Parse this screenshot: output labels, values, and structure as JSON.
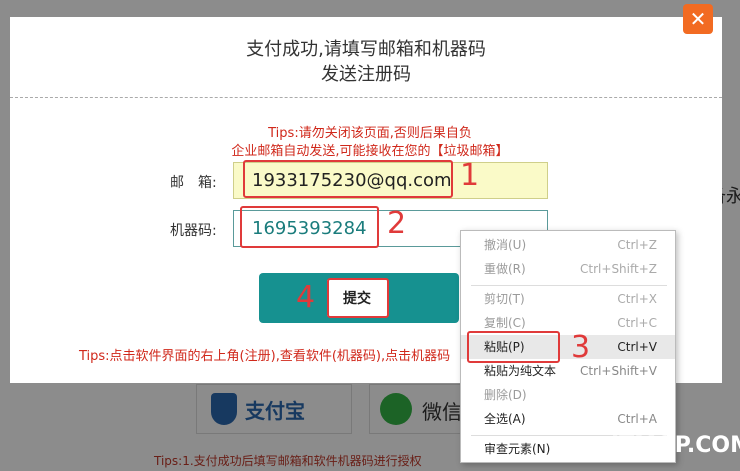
{
  "background": {
    "pay_alipay_label": "支付宝",
    "pay_wechat_label": "微信",
    "bottom_tip": "Tips:1.支付成功后填写邮箱和软件机器码进行授权",
    "side_text": "备永久"
  },
  "modal": {
    "title_line1": "支付成功,请填写邮箱和机器码",
    "title_line2": "发送注册码",
    "tip1": "Tips:请勿关闭该页面,否则后果自负",
    "tip2": "企业邮箱自动发送,可能接收在您的【垃圾邮箱】",
    "email_label": "邮　箱:",
    "email_value": "1933175230@qq.com",
    "code_label": "机器码:",
    "code_value": "1695393284",
    "submit_label": "提交",
    "bottom_tip": "Tips:点击软件界面的右上角(注册),查看软件(机器码),点击机器码",
    "close_glyph": "✕"
  },
  "annotations": {
    "n1": "1",
    "n2": "2",
    "n3": "3",
    "n4": "4"
  },
  "context_menu": {
    "items": [
      {
        "label": "撤消(U)",
        "shortcut": "Ctrl+Z"
      },
      {
        "label": "重做(R)",
        "shortcut": "Ctrl+Shift+Z"
      },
      {
        "label": "剪切(T)",
        "shortcut": "Ctrl+X"
      },
      {
        "label": "复制(C)",
        "shortcut": "Ctrl+C"
      },
      {
        "label": "粘贴(P)",
        "shortcut": "Ctrl+V"
      },
      {
        "label": "粘贴为纯文本",
        "shortcut": "Ctrl+Shift+V"
      },
      {
        "label": "删除(D)",
        "shortcut": ""
      },
      {
        "label": "全选(A)",
        "shortcut": "Ctrl+A"
      },
      {
        "label": "审查元素(N)",
        "shortcut": ""
      }
    ]
  },
  "watermark": "ITMOP.COM",
  "colors": {
    "accent": "#169190",
    "close_orange": "#f26b22",
    "tip_red": "#d0281b",
    "annotation_red": "#e03a3a"
  }
}
